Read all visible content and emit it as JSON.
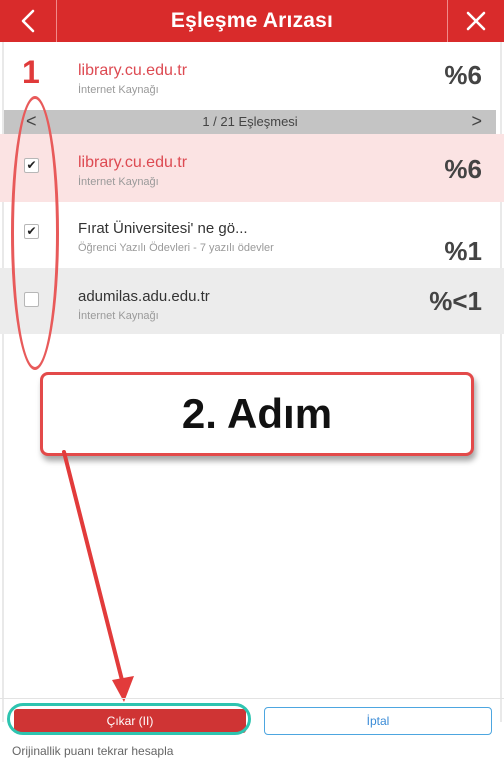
{
  "header": {
    "back_icon": "chevron-left-icon",
    "title": "Eşleşme Arızası",
    "close_icon": "close-icon"
  },
  "annotations": {
    "step1": "1",
    "step2": "2. Adım"
  },
  "top_match": {
    "title": "library.cu.edu.tr",
    "subtitle": "İnternet Kaynağı",
    "percent": "%6"
  },
  "pagination": {
    "prev": "<",
    "label": "1 / 21 Eşleşmesi",
    "next": ">"
  },
  "matches": [
    {
      "checked": true,
      "title": "library.cu.edu.tr",
      "subtitle": "İnternet Kaynağı",
      "percent": "%6",
      "highlight": true
    },
    {
      "checked": true,
      "title": "Fırat Üniversitesi' ne gö...",
      "subtitle": "Öğrenci Yazılı Ödevleri - 7 yazılı ödevler",
      "percent": "%1",
      "highlight": false
    },
    {
      "checked": false,
      "title": "adumilas.adu.edu.tr",
      "subtitle": "İnternet Kaynağı",
      "percent": "%<1",
      "highlight": false
    }
  ],
  "actions": {
    "remove_label": "Çıkar (II)",
    "cancel_label": "İptal",
    "recalc_label": "Orijinallik puanı tekrar hesapla"
  },
  "colors": {
    "brand_red": "#d92b2b",
    "link_red": "#dd4a52",
    "highlight_row": "#fbe3e3",
    "annotation_teal": "#2ec4b0",
    "cancel_blue": "#3a8bd6"
  }
}
